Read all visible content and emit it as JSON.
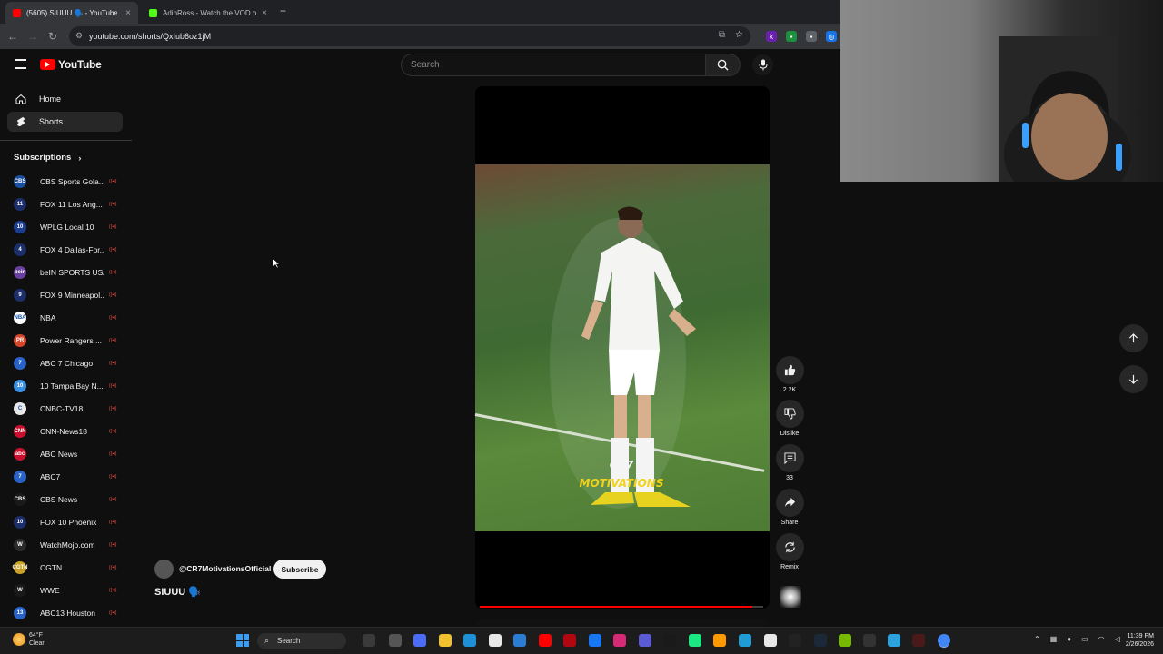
{
  "browser": {
    "tabs": [
      {
        "label": "(5605) SIUUU 🗣️ - YouTube",
        "favicon_color": "#ff0000",
        "active": true
      },
      {
        "label": "AdinRoss - Watch the VOD on",
        "favicon_color": "#53fc18",
        "active": false
      }
    ],
    "new_tab_label": "+",
    "url": "youtube.com/shorts/QxIub6oz1jM"
  },
  "yt": {
    "logo_text": "YouTube",
    "search_placeholder": "Search"
  },
  "sidebar": {
    "nav": [
      {
        "label": "Home",
        "icon": "home-icon"
      },
      {
        "label": "Shorts",
        "icon": "shorts-icon"
      }
    ],
    "subscriptions_label": "Subscriptions",
    "subscriptions": [
      {
        "name": "CBS Sports Gola...",
        "color": "#1a4fa0",
        "badge": "CBS"
      },
      {
        "name": "FOX 11 Los Ang...",
        "color": "#1c2f6b",
        "badge": "11"
      },
      {
        "name": "WPLG Local 10",
        "color": "#1b3d8f",
        "badge": "10"
      },
      {
        "name": "FOX 4 Dallas-For...",
        "color": "#1c2f6b",
        "badge": "4"
      },
      {
        "name": "beIN SPORTS USA",
        "color": "#6b3fa0",
        "badge": "bein"
      },
      {
        "name": "FOX 9 Minneapol...",
        "color": "#1c2f6b",
        "badge": "9"
      },
      {
        "name": "NBA",
        "color": "#ffffff",
        "badge": "NBA"
      },
      {
        "name": "Power Rangers ...",
        "color": "#d4462a",
        "badge": "PR"
      },
      {
        "name": "ABC 7 Chicago",
        "color": "#2a63c7",
        "badge": "7"
      },
      {
        "name": "10 Tampa Bay N...",
        "color": "#3b8fe0",
        "badge": "10"
      },
      {
        "name": "CNBC-TV18",
        "color": "#e8e8e8",
        "badge": "C"
      },
      {
        "name": "CNN-News18",
        "color": "#c8102e",
        "badge": "CNN"
      },
      {
        "name": "ABC News",
        "color": "#c8102e",
        "badge": "abc"
      },
      {
        "name": "ABC7",
        "color": "#2a63c7",
        "badge": "7"
      },
      {
        "name": "CBS News",
        "color": "#1a1a1a",
        "badge": "CBS"
      },
      {
        "name": "FOX 10 Phoenix",
        "color": "#1c2f6b",
        "badge": "10"
      },
      {
        "name": "WatchMojo.com",
        "color": "#2b2b2b",
        "badge": "W"
      },
      {
        "name": "CGTN",
        "color": "#c9a227",
        "badge": "CGTN"
      },
      {
        "name": "WWE",
        "color": "#1a1a1a",
        "badge": "W"
      },
      {
        "name": "ABC13 Houston",
        "color": "#2a63c7",
        "badge": "13"
      }
    ]
  },
  "short": {
    "watermark_line1": "CR7",
    "watermark_line2": "MOTIVATIONS",
    "channel": "@CR7MotivationsOfficial",
    "subscribe_label": "Subscribe",
    "title": "SIUUU 🗣️",
    "progress": 0.96
  },
  "actions": {
    "like_count": "2.2K",
    "dislike_label": "Dislike",
    "comment_count": "33",
    "share_label": "Share",
    "remix_label": "Remix"
  },
  "taskbar": {
    "weather_temp": "64°F",
    "weather_cond": "Clear",
    "search_label": "Search",
    "time": "11:39 PM",
    "date": "2/26/2026"
  }
}
